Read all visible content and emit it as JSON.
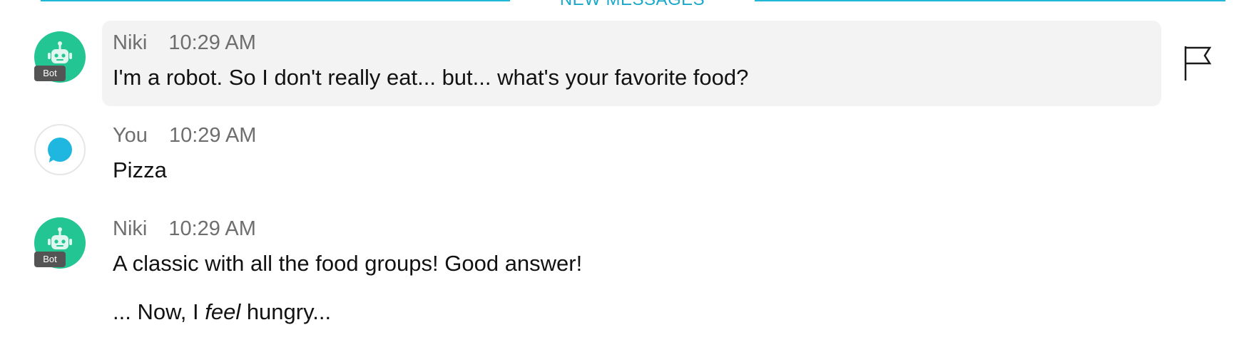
{
  "divider": {
    "label": "NEW MESSAGES"
  },
  "messages": [
    {
      "author": "Niki",
      "time": "10:29 AM",
      "badge": "Bot",
      "text": "I'm a robot. So I don't really eat... but... what's your favorite food?"
    },
    {
      "author": "You",
      "time": "10:29 AM",
      "text": "Pizza"
    },
    {
      "author": "Niki",
      "time": "10:29 AM",
      "badge": "Bot",
      "text_line1": "A classic with all the food groups! Good answer!",
      "text_line2_prefix": "... Now, I ",
      "text_line2_emphasis": "feel",
      "text_line2_suffix": " hungry..."
    }
  ],
  "actions": {
    "flag_icon": "flag-icon"
  },
  "colors": {
    "accent": "#21b8d8",
    "bot_avatar": "#23c592",
    "user_bubble": "#1fb6e0",
    "highlight": "#f3f3f3"
  }
}
